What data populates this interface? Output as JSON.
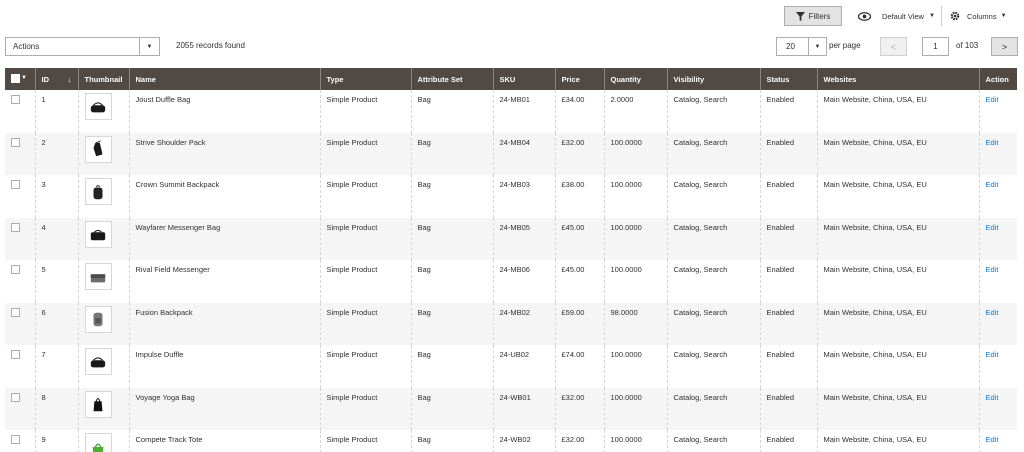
{
  "toolbar": {
    "filters_label": "Filters",
    "view_label": "Default View",
    "columns_label": "Columns"
  },
  "actions": {
    "label": "Actions"
  },
  "records": {
    "text": "2055 records found"
  },
  "pagination": {
    "per_page_value": "20",
    "per_page_label": "per page",
    "prev": "<",
    "current_page": "1",
    "of_pages": "of 103",
    "next": ">"
  },
  "table": {
    "headers": {
      "id": "ID",
      "id_sort": "↓",
      "thumbnail": "Thumbnail",
      "name": "Name",
      "type": "Type",
      "attribute_set": "Attribute Set",
      "sku": "SKU",
      "price": "Price",
      "quantity": "Quantity",
      "visibility": "Visibility",
      "status": "Status",
      "websites": "Websites",
      "action": "Action"
    },
    "rows": [
      {
        "id": "1",
        "name": "Joust Duffle Bag",
        "type": "Simple Product",
        "attribute_set": "Bag",
        "sku": "24-MB01",
        "price": "£34.00",
        "quantity": "2.0000",
        "visibility": "Catalog, Search",
        "status": "Enabled",
        "websites": "Main Website, China, USA, EU",
        "action": "Edit",
        "thumb_icon": "duffle-bag-icon"
      },
      {
        "id": "2",
        "name": "Strive Shoulder Pack",
        "type": "Simple Product",
        "attribute_set": "Bag",
        "sku": "24-MB04",
        "price": "£32.00",
        "quantity": "100.0000",
        "visibility": "Catalog, Search",
        "status": "Enabled",
        "websites": "Main Website, China, USA, EU",
        "action": "Edit",
        "thumb_icon": "shoulder-pack-icon"
      },
      {
        "id": "3",
        "name": "Crown Summit Backpack",
        "type": "Simple Product",
        "attribute_set": "Bag",
        "sku": "24-MB03",
        "price": "£38.00",
        "quantity": "100.0000",
        "visibility": "Catalog, Search",
        "status": "Enabled",
        "websites": "Main Website, China, USA, EU",
        "action": "Edit",
        "thumb_icon": "backpack-icon"
      },
      {
        "id": "4",
        "name": "Wayfarer Messenger Bag",
        "type": "Simple Product",
        "attribute_set": "Bag",
        "sku": "24-MB05",
        "price": "£45.00",
        "quantity": "100.0000",
        "visibility": "Catalog, Search",
        "status": "Enabled",
        "websites": "Main Website, China, USA, EU",
        "action": "Edit",
        "thumb_icon": "messenger-bag-icon"
      },
      {
        "id": "5",
        "name": "Rival Field Messenger",
        "type": "Simple Product",
        "attribute_set": "Bag",
        "sku": "24-MB06",
        "price": "£45.00",
        "quantity": "100.0000",
        "visibility": "Catalog, Search",
        "status": "Enabled",
        "websites": "Main Website, China, USA, EU",
        "action": "Edit",
        "thumb_icon": "field-messenger-icon"
      },
      {
        "id": "6",
        "name": "Fusion Backpack",
        "type": "Simple Product",
        "attribute_set": "Bag",
        "sku": "24-MB02",
        "price": "£59.00",
        "quantity": "98.0000",
        "visibility": "Catalog, Search",
        "status": "Enabled",
        "websites": "Main Website, China, USA, EU",
        "action": "Edit",
        "thumb_icon": "fusion-backpack-icon"
      },
      {
        "id": "7",
        "name": "Impulse Duffle",
        "type": "Simple Product",
        "attribute_set": "Bag",
        "sku": "24-UB02",
        "price": "£74.00",
        "quantity": "100.0000",
        "visibility": "Catalog, Search",
        "status": "Enabled",
        "websites": "Main Website, China, USA, EU",
        "action": "Edit",
        "thumb_icon": "duffle-bag-icon"
      },
      {
        "id": "8",
        "name": "Voyage Yoga Bag",
        "type": "Simple Product",
        "attribute_set": "Bag",
        "sku": "24-WB01",
        "price": "£32.00",
        "quantity": "100.0000",
        "visibility": "Catalog, Search",
        "status": "Enabled",
        "websites": "Main Website, China, USA, EU",
        "action": "Edit",
        "thumb_icon": "yoga-bag-icon"
      },
      {
        "id": "9",
        "name": "Compete Track Tote",
        "type": "Simple Product",
        "attribute_set": "Bag",
        "sku": "24-WB02",
        "price": "£32.00",
        "quantity": "100.0000",
        "visibility": "Catalog, Search",
        "status": "Enabled",
        "websites": "Main Website, China, USA, EU",
        "action": "Edit",
        "thumb_icon": "tote-bag-icon"
      }
    ]
  }
}
